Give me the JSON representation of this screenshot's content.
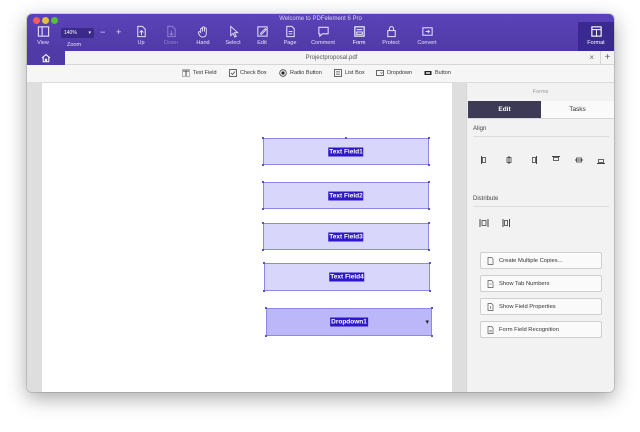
{
  "window": {
    "title": "Welcome to PDFelement 6 Pro"
  },
  "toolbar": {
    "view": "View",
    "zoom": "Zoom",
    "zoom_value": "140%",
    "zoom_out": "−",
    "zoom_in": "+",
    "up": "Up",
    "down": "Down",
    "hand": "Hand",
    "select": "Select",
    "edit": "Edit",
    "page": "Page",
    "comment": "Comment",
    "form": "Form",
    "protect": "Protect",
    "convert": "Convert",
    "format": "Format"
  },
  "tabs": {
    "document": "Projectproposal.pdf",
    "close": "×",
    "add": "+"
  },
  "form_bar": {
    "text_field": "Text Field",
    "check_box": "Check Box",
    "radio_button": "Radio Button",
    "list_box": "List Box",
    "dropdown": "Dropdown",
    "button": "Button"
  },
  "fields": [
    {
      "label": "Text Field1"
    },
    {
      "label": "Text Field2"
    },
    {
      "label": "Text Field3"
    },
    {
      "label": "Text Field4"
    },
    {
      "label": "Dropdown1",
      "caret": "▾"
    }
  ],
  "panel": {
    "title": "Forms",
    "tabs": [
      "Edit",
      "Tasks"
    ],
    "active_tab": "Edit",
    "align_label": "Align",
    "align_icons": [
      "align-left-icon",
      "align-center-icon",
      "align-right-icon",
      "align-top-icon",
      "align-middle-icon",
      "align-bottom-icon"
    ],
    "distribute_label": "Distribute",
    "distribute_icons": [
      "distribute-horizontal-icon",
      "distribute-vertical-icon"
    ],
    "buttons": [
      "Create Multiple Copies...",
      "Show Tab Numbers",
      "Show Field Properties",
      "Form Field Recognition"
    ]
  },
  "colors": {
    "toolbar": "#4f3aa6",
    "field_fill": "#d9d6fb",
    "field_label_bg": "#2c17c9",
    "panel_tab_active": "#3c3a55"
  }
}
